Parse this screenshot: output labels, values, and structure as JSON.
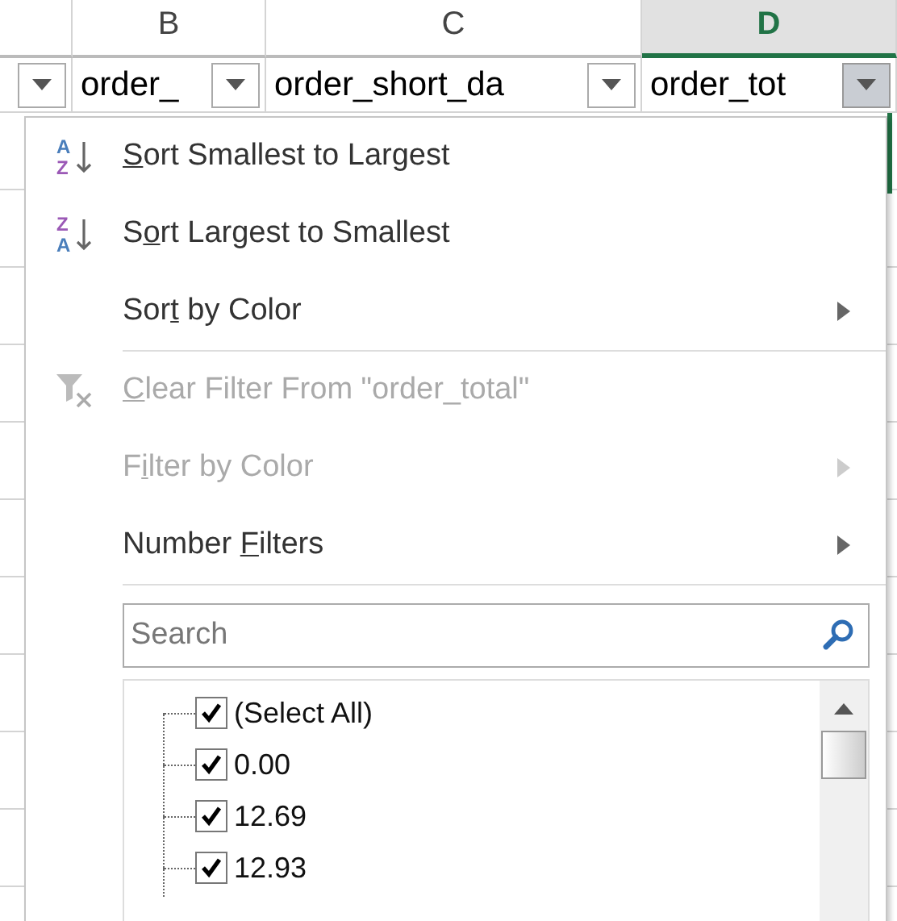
{
  "column_headers": [
    {
      "selected": false
    },
    {
      "label": "B",
      "selected": false
    },
    {
      "label": "C",
      "selected": false
    },
    {
      "label": "D",
      "selected": true
    }
  ],
  "header_cells": [
    {
      "pressed": false
    },
    {
      "text": "order_",
      "pressed": false
    },
    {
      "text": "order_short_da",
      "pressed": false
    },
    {
      "text": "order_tot",
      "pressed": true
    }
  ],
  "menu": {
    "items": [
      {
        "kind": "sort-asc",
        "icon_letters": [
          "A",
          "Z"
        ],
        "key": "S",
        "after": "ort Smallest to Largest",
        "disabled": false,
        "submenu": false
      },
      {
        "kind": "sort-desc",
        "icon_letters": [
          "Z",
          "A"
        ],
        "before": "S",
        "key": "o",
        "after": "rt Largest to Smallest",
        "disabled": false,
        "submenu": false
      },
      {
        "kind": "plain",
        "before": "Sor",
        "key": "t",
        "after": " by Color",
        "disabled": false,
        "submenu": true
      },
      {
        "kind": "separator"
      },
      {
        "kind": "clear-filter",
        "key": "C",
        "after": "lear Filter From \"order_total\"",
        "disabled": true,
        "submenu": false
      },
      {
        "kind": "plain",
        "before": "F",
        "key": "i",
        "after": "lter by Color",
        "disabled": true,
        "submenu": true
      },
      {
        "kind": "plain",
        "before": "Number ",
        "key": "F",
        "after": "ilters",
        "disabled": false,
        "submenu": true
      },
      {
        "kind": "separator"
      }
    ],
    "search": {
      "placeholder": "Search"
    },
    "values": [
      {
        "label": "(Select All)",
        "checked": true
      },
      {
        "label": "0.00",
        "checked": true
      },
      {
        "label": "12.69",
        "checked": true
      },
      {
        "label": "12.93",
        "checked": true
      }
    ]
  }
}
